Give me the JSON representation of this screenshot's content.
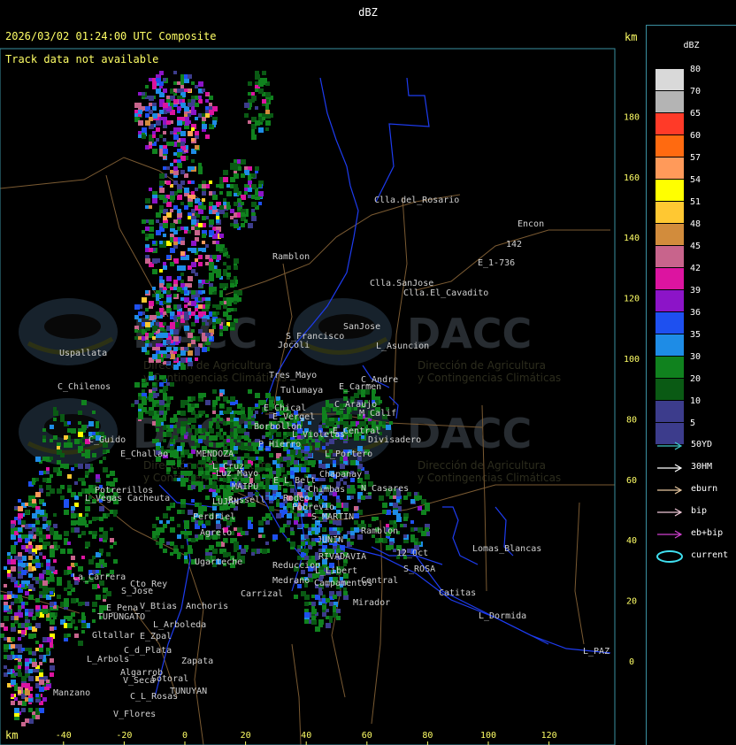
{
  "header": {
    "title": "dBZ",
    "timestamp": "2026/03/02 01:24:00 UTC Composite",
    "track_message": "Track data not available",
    "km_label_top": "km",
    "km_label_bottom": "km"
  },
  "watermark": {
    "brand": "DACC",
    "line1": "Dirección de Agricultura",
    "line2": "y Contingencias Climáticas"
  },
  "axes": {
    "x_ticks": [
      "-40",
      "-20",
      "0",
      "20",
      "40",
      "60",
      "80",
      "100",
      "120"
    ],
    "y_ticks": [
      "180",
      "160",
      "140",
      "120",
      "100",
      "80",
      "60",
      "40",
      "20",
      "0"
    ]
  },
  "legend": {
    "title": "dBZ",
    "levels": [
      {
        "label": "80",
        "color": "#d9d9d9"
      },
      {
        "label": "70",
        "color": "#b4b4b4"
      },
      {
        "label": "65",
        "color": "#ff3a28"
      },
      {
        "label": "60",
        "color": "#ff6a10"
      },
      {
        "label": "57",
        "color": "#ff9a5a"
      },
      {
        "label": "54",
        "color": "#ffff00"
      },
      {
        "label": "51",
        "color": "#ffc832"
      },
      {
        "label": "48",
        "color": "#d28c3c"
      },
      {
        "label": "45",
        "color": "#c8648c"
      },
      {
        "label": "42",
        "color": "#dc14a0"
      },
      {
        "label": "39",
        "color": "#8c14c8"
      },
      {
        "label": "36",
        "color": "#1e50f0"
      },
      {
        "label": "35",
        "color": "#1e8ce6"
      },
      {
        "label": "30",
        "color": "#10821e"
      },
      {
        "label": "20",
        "color": "#0a5a14"
      },
      {
        "label": "10",
        "color": "#3c3c8c"
      },
      {
        "label": "5",
        "color": "#3c3c8c"
      }
    ],
    "tracks": [
      {
        "label": "50YD",
        "color": "#40c8c8"
      },
      {
        "label": "30HM",
        "color": "#ffffff"
      },
      {
        "label": "eburn",
        "color": "#e8c8a0"
      },
      {
        "label": "bip",
        "color": "#f0c8d8"
      },
      {
        "label": "eb+bip",
        "color": "#d040d0"
      },
      {
        "label": "current",
        "color": "#40e0f0"
      }
    ]
  },
  "places": [
    {
      "name": "Clla.del_Rosario"
    },
    {
      "name": "Encon"
    },
    {
      "name": "E_1-736"
    },
    {
      "name": "142"
    },
    {
      "name": "Ramblon"
    },
    {
      "name": "Clla.SanJose"
    },
    {
      "name": "Clla.El_Cavadito"
    },
    {
      "name": "S_Francisco"
    },
    {
      "name": "SanJose"
    },
    {
      "name": "L_Asuncion"
    },
    {
      "name": "Jocoli"
    },
    {
      "name": "Uspallata"
    },
    {
      "name": "Tres_Mayo"
    },
    {
      "name": "Tulumaya"
    },
    {
      "name": "C_Andre"
    },
    {
      "name": "E_Carmen"
    },
    {
      "name": "C_Chilenos"
    },
    {
      "name": "C_Araujo"
    },
    {
      "name": "E_Chical"
    },
    {
      "name": "E_Vergel"
    },
    {
      "name": "M_Calif"
    },
    {
      "name": "Borbollon"
    },
    {
      "name": "L_Violetas"
    },
    {
      "name": "E_Central"
    },
    {
      "name": "Divisadero"
    },
    {
      "name": "C_Guido"
    },
    {
      "name": "P_Hierro"
    },
    {
      "name": "L_Portero"
    },
    {
      "name": "E_Challao"
    },
    {
      "name": "MENDOZA"
    },
    {
      "name": "Chapanay"
    },
    {
      "name": "Potrerillos"
    },
    {
      "name": "L_Vegas"
    },
    {
      "name": "Cacheuta"
    },
    {
      "name": "MAIPU"
    },
    {
      "name": "E_L_Belt"
    },
    {
      "name": "Chimbas"
    },
    {
      "name": "N_Casares"
    },
    {
      "name": "LUJAN"
    },
    {
      "name": "Perdriel"
    },
    {
      "name": "Agrelo"
    },
    {
      "name": "S_MARTIN"
    },
    {
      "name": "Ramblon"
    },
    {
      "name": "Ugarteche"
    },
    {
      "name": "JUNIN"
    },
    {
      "name": "RIVADAVIA"
    },
    {
      "name": "Lomas_Blancas"
    },
    {
      "name": "12_Oct"
    },
    {
      "name": "S_ROSA"
    },
    {
      "name": "Medrano"
    },
    {
      "name": "L_Libert"
    },
    {
      "name": "Reduccion"
    },
    {
      "name": "Campamentos"
    },
    {
      "name": "Central"
    },
    {
      "name": "Catitas"
    },
    {
      "name": "La_Carrera"
    },
    {
      "name": "Cto_Rey"
    },
    {
      "name": "S_Jose"
    },
    {
      "name": "Carrizal"
    },
    {
      "name": "Mirador"
    },
    {
      "name": "E_Pena"
    },
    {
      "name": "TUPUNGATO"
    },
    {
      "name": "V_Btias"
    },
    {
      "name": "Anchoris"
    },
    {
      "name": "L_Dormida"
    },
    {
      "name": "L_Arboleda"
    },
    {
      "name": "Gltallar"
    },
    {
      "name": "E_Zpal"
    },
    {
      "name": "L_Arbols"
    },
    {
      "name": "C_d_Plata"
    },
    {
      "name": "Zapata"
    },
    {
      "name": "L_PAZ"
    },
    {
      "name": "Algarrob"
    },
    {
      "name": "V_Seca"
    },
    {
      "name": "Sotoral"
    },
    {
      "name": "TUNUYAN"
    },
    {
      "name": "Manzano"
    },
    {
      "name": "C_L_Rosas"
    },
    {
      "name": "V_Flores"
    },
    {
      "name": "Rodeo"
    },
    {
      "name": "Russell"
    },
    {
      "name": "L_Cruz"
    },
    {
      "name": "Luz_Mayo"
    },
    {
      "name": "Pobrevio"
    }
  ]
}
